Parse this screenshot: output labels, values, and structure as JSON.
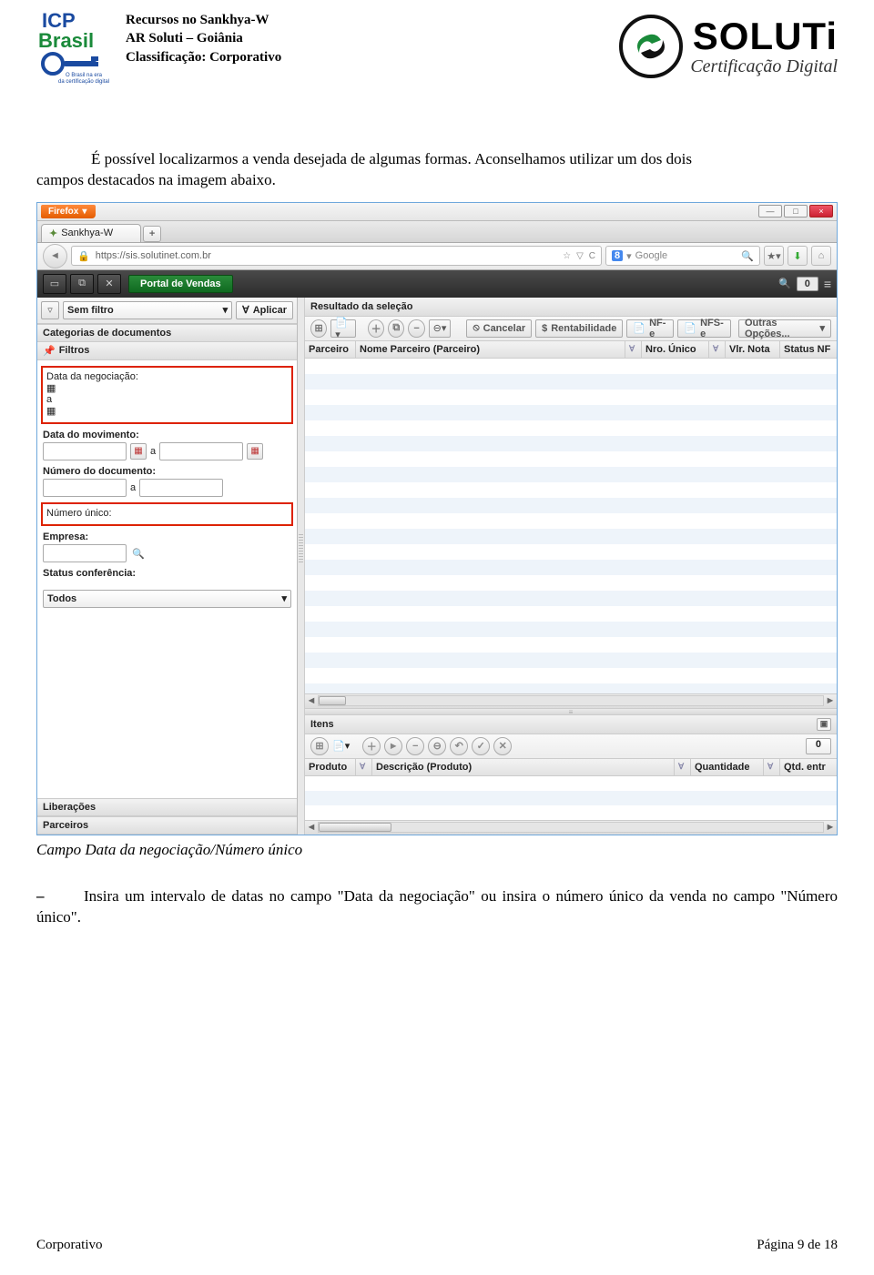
{
  "header": {
    "line1": "Recursos no Sankhya-W",
    "line2": "AR Soluti – Goiânia",
    "line3": "Classificação: Corporativo",
    "icp": {
      "top": "ICP",
      "bottom": "Brasil",
      "sub1": "O Brasil na era",
      "sub2": "da certificação digital"
    },
    "soluti": {
      "brand": "SOLUTi",
      "tag": "Certificação Digital"
    }
  },
  "para1a": "É possível localizarmos a venda desejada de algumas formas. Aconselhamos utilizar um dos dois",
  "para1b": "campos destacados na imagem abaixo.",
  "ff": {
    "appbtn": "Firefox",
    "tab": "Sankhya-W",
    "plus": "+",
    "url": "https://sis.solutinet.com.br",
    "star": "☆",
    "reload": "C",
    "search_prefix": "8",
    "search_placeholder": "Google",
    "win_min": "—",
    "win_max": "□",
    "win_close": "×"
  },
  "appbar": {
    "portal": "Portal de Vendas",
    "count": "0"
  },
  "left": {
    "nofilter": "Sem filtro",
    "apply": "Aplicar",
    "categorias": "Categorias de documentos",
    "filtros": "Filtros",
    "f1": "Data da negociação:",
    "f2": "Data do movimento:",
    "f3": "Número do documento:",
    "f4": "Número único:",
    "f5": "Empresa:",
    "f6": "Status conferência:",
    "a": "a",
    "todos": "Todos",
    "liberacoes": "Liberações",
    "parceiros": "Parceiros"
  },
  "right": {
    "resultado": "Resultado da seleção",
    "cancelar": "Cancelar",
    "rentab": "Rentabilidade",
    "nfe": "NF-e",
    "nfse": "NFS-e",
    "outras": "Outras Opções...",
    "col_parceiro": "Parceiro",
    "col_nome": "Nome Parceiro (Parceiro)",
    "col_nro": "Nro. Único",
    "col_vlr": "Vlr. Nota",
    "col_status": "Status NF",
    "itens": "Itens",
    "itens_count": "0",
    "col_prod": "Produto",
    "col_desc": "Descrição (Produto)",
    "col_qtd": "Quantidade",
    "col_qtde": "Qtd. entr"
  },
  "caption": "Campo Data da negociação/Número único",
  "instr_dash": "–",
  "instr": "Insira um intervalo de datas no campo \"Data da negociação\" ou insira o número único da venda no campo \"Número único\".",
  "footer": {
    "left": "Corporativo",
    "right": "Página 9 de 18"
  }
}
